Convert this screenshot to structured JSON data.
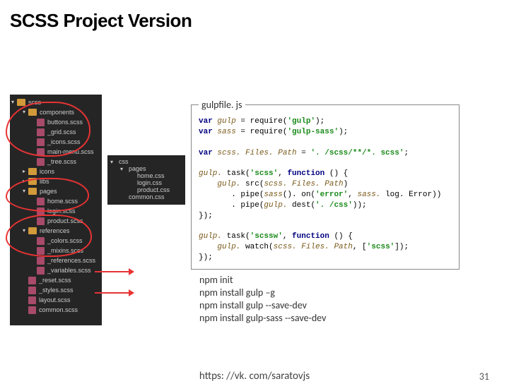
{
  "title": "SCSS Project Version",
  "scss_tree": {
    "root": "scss",
    "items": [
      {
        "type": "folder",
        "open": true,
        "name": "components",
        "children": [
          {
            "type": "file",
            "name": "buttons.scss"
          },
          {
            "type": "file",
            "name": "_grid.scss"
          },
          {
            "type": "file",
            "name": "_icons.scss"
          },
          {
            "type": "file",
            "name": "main-menu.scss"
          },
          {
            "type": "file",
            "name": "_tree.scss"
          }
        ]
      },
      {
        "type": "folder",
        "open": false,
        "name": "icons"
      },
      {
        "type": "folder",
        "open": false,
        "name": "libs"
      },
      {
        "type": "folder",
        "open": true,
        "name": "pages",
        "children": [
          {
            "type": "file",
            "name": "home.scss"
          },
          {
            "type": "file",
            "name": "login.scss"
          },
          {
            "type": "file",
            "name": "product.scss"
          }
        ]
      },
      {
        "type": "folder",
        "open": true,
        "name": "references",
        "children": [
          {
            "type": "file",
            "name": "_colors.scss"
          },
          {
            "type": "file",
            "name": "_mixins.scss"
          },
          {
            "type": "file",
            "name": "_references.scss"
          },
          {
            "type": "file",
            "name": "_variables.scss"
          }
        ]
      },
      {
        "type": "file",
        "name": "_reset.scss"
      },
      {
        "type": "file",
        "name": "_styles.scss"
      },
      {
        "type": "file",
        "name": "layout.scss"
      },
      {
        "type": "file",
        "name": "common.scss"
      }
    ]
  },
  "css_tree": {
    "root": "css",
    "items": [
      {
        "type": "folder",
        "open": true,
        "name": "pages",
        "children": [
          {
            "type": "file",
            "name": "home.css"
          },
          {
            "type": "file",
            "name": "login.css"
          },
          {
            "type": "file",
            "name": "product.css"
          }
        ]
      },
      {
        "type": "file",
        "name": "common.css"
      }
    ]
  },
  "code_box_label": "gulpfile. js",
  "code_tokens": [
    [
      [
        "kw",
        "var "
      ],
      [
        "var",
        "gulp"
      ],
      [
        "fn",
        " = require("
      ],
      [
        "str",
        "'gulp'"
      ],
      [
        "fn",
        ");"
      ]
    ],
    [
      [
        "kw",
        "var "
      ],
      [
        "var",
        "sass"
      ],
      [
        "fn",
        " = require("
      ],
      [
        "str",
        "'gulp-sass'"
      ],
      [
        "fn",
        ");"
      ]
    ],
    [],
    [
      [
        "kw",
        "var "
      ],
      [
        "var",
        "scss. Files. Path"
      ],
      [
        "fn",
        " = "
      ],
      [
        "str",
        "'. /scss/**/*. scss'"
      ],
      [
        "fn",
        ";"
      ]
    ],
    [],
    [
      [
        "var",
        "gulp."
      ],
      [
        "fn",
        " task("
      ],
      [
        "str",
        "'scss'"
      ],
      [
        "fn",
        ", "
      ],
      [
        "kw",
        "function"
      ],
      [
        "fn",
        " () {"
      ]
    ],
    [
      [
        "fn",
        "    "
      ],
      [
        "var",
        "gulp."
      ],
      [
        "fn",
        " src("
      ],
      [
        "var",
        "scss. Files. Path"
      ],
      [
        "fn",
        ")"
      ]
    ],
    [
      [
        "fn",
        "       . pipe("
      ],
      [
        "var",
        "sass"
      ],
      [
        "fn",
        "(). on("
      ],
      [
        "str",
        "'error'"
      ],
      [
        "fn",
        ", "
      ],
      [
        "var",
        "sass."
      ],
      [
        "fn",
        " log. Error))"
      ]
    ],
    [
      [
        "fn",
        "       . pipe("
      ],
      [
        "var",
        "gulp."
      ],
      [
        "fn",
        " dest("
      ],
      [
        "str",
        "'. /css'"
      ],
      [
        "fn",
        "));"
      ]
    ],
    [
      [
        "fn",
        "});"
      ]
    ],
    [],
    [
      [
        "var",
        "gulp."
      ],
      [
        "fn",
        " task("
      ],
      [
        "str",
        "'scssw'"
      ],
      [
        "fn",
        ", "
      ],
      [
        "kw",
        "function"
      ],
      [
        "fn",
        " () {"
      ]
    ],
    [
      [
        "fn",
        "    "
      ],
      [
        "var",
        "gulp."
      ],
      [
        "fn",
        " watch("
      ],
      [
        "var",
        "scss. Files. Path"
      ],
      [
        "fn",
        ", ["
      ],
      [
        "str",
        "'scss'"
      ],
      [
        "fn",
        "]);"
      ]
    ],
    [
      [
        "fn",
        "});"
      ]
    ]
  ],
  "commands": [
    "npm init",
    "npm install gulp –g",
    "npm install gulp --save-dev",
    "npm install gulp-sass --save-dev"
  ],
  "footer_url": "https: //vk. com/saratovjs",
  "page_number": "31"
}
